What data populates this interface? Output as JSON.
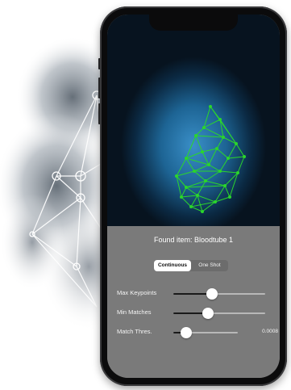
{
  "status": {
    "found_label": "Found item: Bloodtube 1"
  },
  "mode_selector": {
    "options": [
      {
        "label": "Continuous",
        "selected": true
      },
      {
        "label": "One Shot",
        "selected": false
      }
    ]
  },
  "sliders": [
    {
      "label": "Max Keypoints",
      "level": 0.42,
      "value_text": ""
    },
    {
      "label": "Min Matches",
      "level": 0.38,
      "value_text": ""
    },
    {
      "label": "Match Thres.",
      "level": 0.2,
      "value_text": "0.0008"
    }
  ],
  "colors": {
    "mesh_line": "#2bd62b",
    "panel_bg": "#7a7a7a",
    "slider_fill": "#1a1a1a",
    "slider_track": "#b8b8b8"
  },
  "icons": {
    "keypoint_marker": "green-dot",
    "background_art": "node-network-illustration"
  }
}
